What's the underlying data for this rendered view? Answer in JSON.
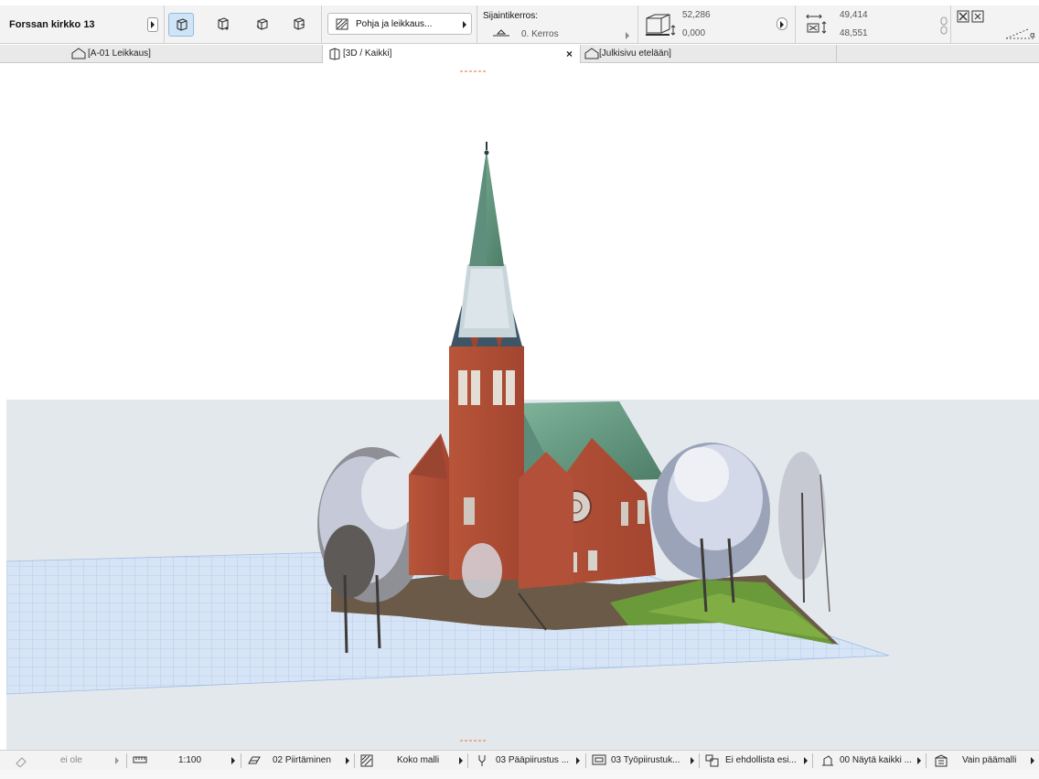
{
  "infobar": {
    "project_name": "Forssan kirkko 13",
    "viewpoint_dropdown": "Pohja ja leikkaus...",
    "story_label": "Sijaintikerros:",
    "story_value": "0. Kerros",
    "box_top_value": "52,286",
    "box_bottom_value": "0,000",
    "width_value": "49,414",
    "height_value": "48,551"
  },
  "tabs": [
    {
      "label": "[A-01 Leikkaus]",
      "icon": "section-icon"
    },
    {
      "label": "[3D / Kaikki]",
      "icon": "3d-window-icon",
      "active": true,
      "close": "×"
    },
    {
      "label": "[Julkisivu etelään]",
      "icon": "elevation-icon"
    }
  ],
  "statusbar": {
    "undo_label": "ei ole",
    "scale": "1:100",
    "layer_combo": "02 Piirtäminen",
    "model_view": "Koko malli",
    "pen_set": "03 Pääpiirustus ...",
    "model_view_options": "03 Työpiirustuk...",
    "renovation_filter": "Ei ehdollista esi...",
    "graphic_override": "00 Näytä kaikki ...",
    "structure_display": "Vain päämalli"
  },
  "colors": {
    "accent": "#cfe5f7",
    "background": "#f3f3f3",
    "grid": "#bcd2ef",
    "horizon": "#e3e8ec"
  }
}
